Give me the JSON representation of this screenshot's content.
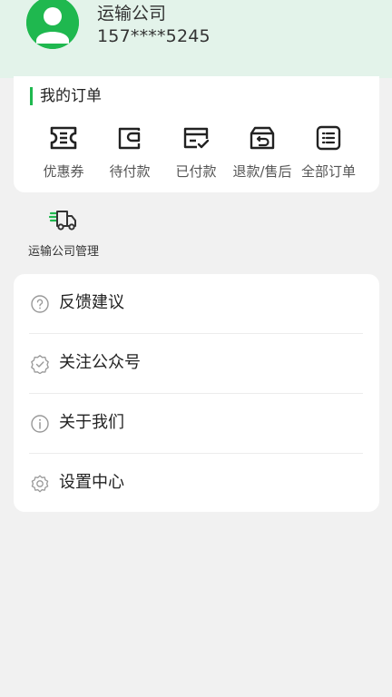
{
  "profile": {
    "company_name": "运输公司",
    "phone": "157****5245"
  },
  "orders": {
    "title": "我的订单",
    "items": [
      {
        "label": "优惠券",
        "icon": "coupon-icon"
      },
      {
        "label": "待付款",
        "icon": "wallet-icon"
      },
      {
        "label": "已付款",
        "icon": "paid-card-icon"
      },
      {
        "label": "退款/售后",
        "icon": "refund-icon"
      },
      {
        "label": "全部订单",
        "icon": "list-icon"
      }
    ]
  },
  "shortcuts": {
    "company_management": {
      "label": "运输公司管理",
      "icon": "truck-icon"
    }
  },
  "menu": {
    "items": [
      {
        "label": "反馈建议",
        "icon": "question-circle-icon"
      },
      {
        "label": "关注公众号",
        "icon": "badge-check-icon"
      },
      {
        "label": "关于我们",
        "icon": "info-circle-icon"
      },
      {
        "label": "设置中心",
        "icon": "gear-icon"
      }
    ]
  },
  "colors": {
    "accent": "#1fb84f",
    "header_bg": "#e3f3ea",
    "page_bg": "#f1f1f1"
  }
}
